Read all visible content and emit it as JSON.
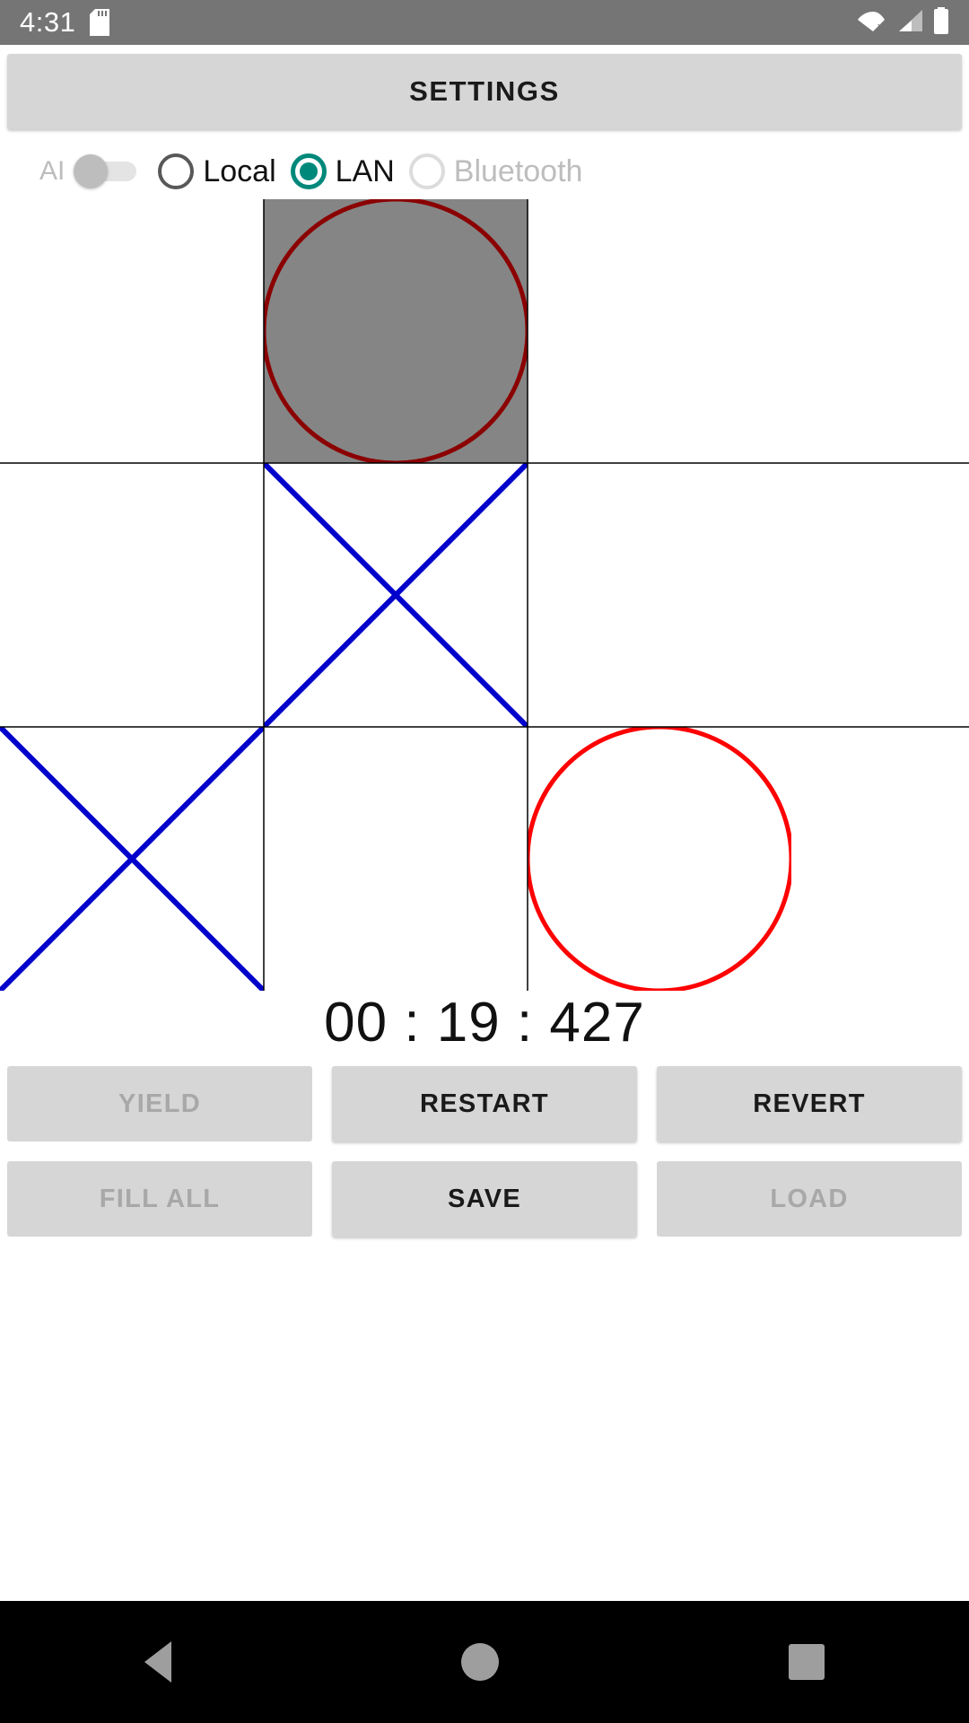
{
  "status_bar": {
    "time": "4:31",
    "icons": [
      "sd-card-icon",
      "wifi-off-icon",
      "cell-signal-icon",
      "battery-icon"
    ]
  },
  "settings": {
    "label": "SETTINGS"
  },
  "controls": {
    "ai": {
      "label": "AI",
      "enabled": false,
      "state": "off"
    },
    "mode": {
      "selected": "LAN",
      "accent_color": "#00897B",
      "options": [
        {
          "label": "Local",
          "selected": false,
          "disabled": false
        },
        {
          "label": "LAN",
          "selected": true,
          "disabled": false
        },
        {
          "label": "Bluetooth",
          "selected": false,
          "disabled": true
        }
      ]
    }
  },
  "board": {
    "rows": 3,
    "cols": 3,
    "grid_line_color": "#000000",
    "highlight_color": "#858585",
    "x_color": "#0000CC",
    "o_color": "#FF0000",
    "o_last_color": "#8B0000",
    "cells": [
      {
        "index": 0,
        "mark": "",
        "highlight": false
      },
      {
        "index": 1,
        "mark": "O",
        "highlight": true,
        "color": "#8B0000"
      },
      {
        "index": 2,
        "mark": "",
        "highlight": false
      },
      {
        "index": 3,
        "mark": "",
        "highlight": false
      },
      {
        "index": 4,
        "mark": "X",
        "highlight": false,
        "color": "#0000CC"
      },
      {
        "index": 5,
        "mark": "",
        "highlight": false
      },
      {
        "index": 6,
        "mark": "X",
        "highlight": false,
        "color": "#0000CC"
      },
      {
        "index": 7,
        "mark": "",
        "highlight": false
      },
      {
        "index": 8,
        "mark": "O",
        "highlight": false,
        "color": "#FF0000"
      }
    ]
  },
  "timer": {
    "text": "00 : 19 : 427",
    "minutes": "00",
    "seconds": "19",
    "millis": "427"
  },
  "actions": {
    "row1": [
      {
        "label": "YIELD",
        "disabled": true
      },
      {
        "label": "RESTART",
        "disabled": false
      },
      {
        "label": "REVERT",
        "disabled": false
      }
    ],
    "row2": [
      {
        "label": "FILL ALL",
        "disabled": true
      },
      {
        "label": "SAVE",
        "disabled": false
      },
      {
        "label": "LOAD",
        "disabled": true
      }
    ]
  },
  "navbar": {
    "back": "back-triangle-icon",
    "home": "home-circle-icon",
    "recents": "recents-square-icon"
  }
}
